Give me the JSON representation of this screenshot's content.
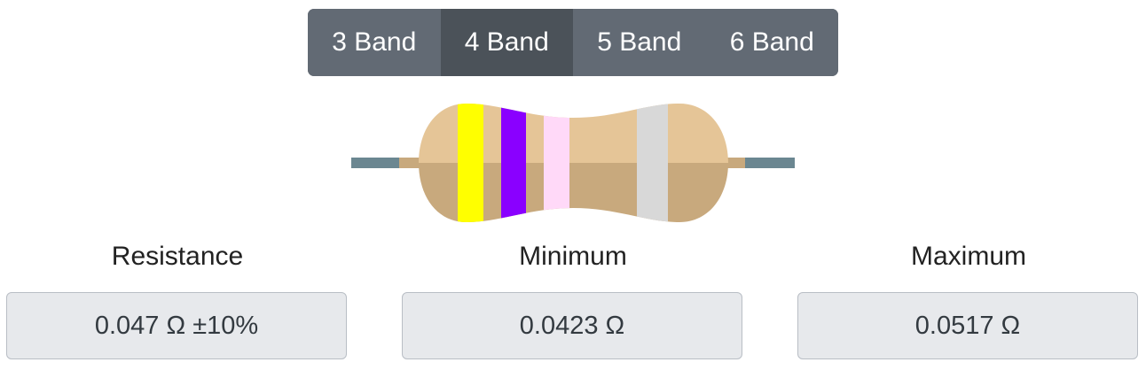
{
  "band_selector": {
    "options": [
      "3 Band",
      "4 Band",
      "5 Band",
      "6 Band"
    ],
    "selected": "4 Band"
  },
  "resistor": {
    "band_colors": {
      "band1": "#ffff00",
      "band2": "#8a00ff",
      "multiplier": "#ffd9f8",
      "tolerance": "#d8d8d8"
    },
    "body_colors": {
      "top": "#e5c597",
      "bottom": "#c8a97d",
      "lead": "#6b8791"
    }
  },
  "results": {
    "resistance": {
      "label": "Resistance",
      "value": "0.047 Ω ±10%"
    },
    "minimum": {
      "label": "Minimum",
      "value": "0.0423 Ω"
    },
    "maximum": {
      "label": "Maximum",
      "value": "0.0517 Ω"
    }
  }
}
